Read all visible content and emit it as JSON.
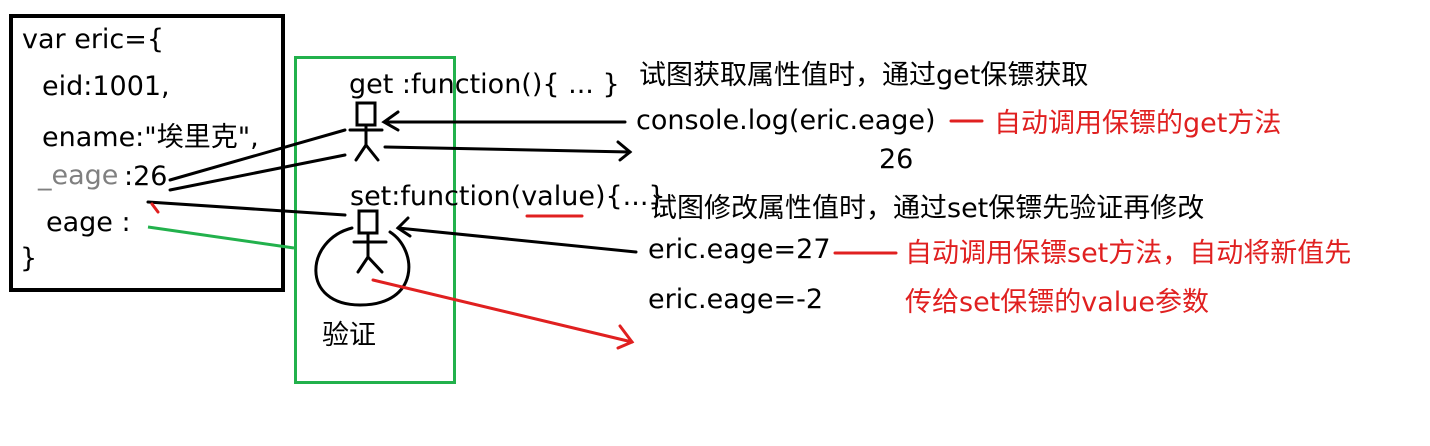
{
  "object_code": {
    "line1": "var eric={",
    "line2": "eid:1001,",
    "line3": "ename:\"埃里克\",",
    "line4_key": "_eage",
    "line4_val": ":26",
    "line5": "eage :",
    "line6": "}"
  },
  "accessor": {
    "get_label": "get :function(){ ... }",
    "set_label_prefix": "set:function(",
    "set_label_param": "value",
    "set_label_suffix": "){...}",
    "verify_label": "验证"
  },
  "get_side": {
    "desc": "试图获取属性值时，通过get保镖获取",
    "call": "console.log(eric.eage)",
    "note": "自动调用保镖的get方法",
    "result": "26"
  },
  "set_side": {
    "desc": "试图修改属性值时，通过set保镖先验证再修改",
    "call1": "eric.eage=27",
    "call2": "eric.eage=-2",
    "note_line1": "自动调用保镖set方法，自动将新值先",
    "note_line2": "传给set保镖的value参数"
  },
  "colors": {
    "black": "#000000",
    "green": "#22b14c",
    "red": "#e02020",
    "gray": "#808080"
  }
}
